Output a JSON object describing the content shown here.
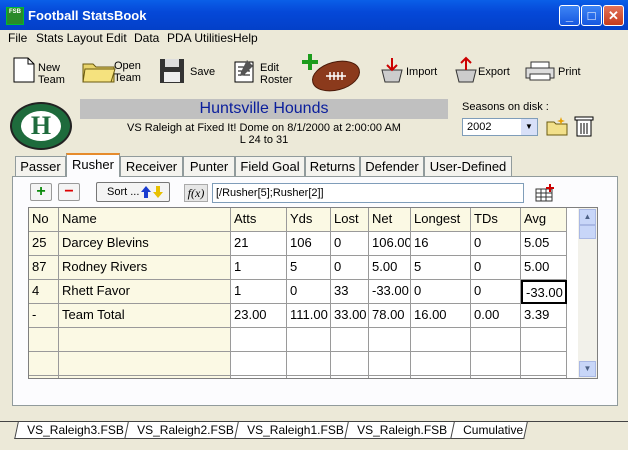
{
  "window": {
    "title": "Football StatsBook",
    "minimize": "_",
    "maximize": "□",
    "close": "✕",
    "app_icon_text": "FSB"
  },
  "menu": [
    "File",
    "Stats Layout",
    "Edit",
    "Data",
    "PDA Utilities",
    "Help"
  ],
  "toolbar": {
    "new_team": [
      "New",
      "Team"
    ],
    "open_team": [
      "Open",
      "Team"
    ],
    "save": "Save",
    "edit_roster": [
      "Edit",
      "Roster"
    ],
    "import": "Import",
    "export": "Export",
    "print": "Print"
  },
  "header": {
    "logo_letter": "H",
    "team_name": "Huntsville Hounds",
    "game_line": "VS Raleigh at Fixed It! Dome on 8/1/2000 at 2:00:00 AM",
    "score_line": "L 24 to 31",
    "seasons_label": "Seasons on disk :",
    "season_selected": "2002"
  },
  "tabs": [
    "Passer",
    "Rusher",
    "Receiver",
    "Punter",
    "Field Goal",
    "Returns",
    "Defender",
    "User-Defined"
  ],
  "active_tab": "Rusher",
  "actions": {
    "add": "+",
    "remove": "−",
    "sort_label": "Sort ...",
    "fx_label": "f(x)",
    "formula": "[/Rusher[5];Rusher[2]]"
  },
  "grid": {
    "columns": [
      "No",
      "Name",
      "Atts",
      "Yds",
      "Lost",
      "Net",
      "Longest",
      "TDs",
      "Avg"
    ],
    "rows": [
      [
        "25",
        "Darcey Blevins",
        "21",
        "106",
        "0",
        "106.00",
        "16",
        "0",
        "5.05"
      ],
      [
        "87",
        "Rodney Rivers",
        "1",
        "5",
        "0",
        "5.00",
        "5",
        "0",
        "5.00"
      ],
      [
        "4",
        "Rhett Favor",
        "1",
        "0",
        "33",
        "-33.00",
        "0",
        "0",
        "-33.00"
      ],
      [
        "-",
        "Team Total",
        "23.00",
        "111.00",
        "33.00",
        "78.00",
        "16.00",
        "0.00",
        "3.39"
      ],
      [
        "",
        "",
        "",
        "",
        "",
        "",
        "",
        "",
        ""
      ],
      [
        "",
        "",
        "",
        "",
        "",
        "",
        "",
        "",
        ""
      ],
      [
        "",
        "",
        "",
        "",
        "",
        "",
        "",
        "",
        ""
      ]
    ]
  },
  "file_tabs": [
    "VS_Raleigh3.FSB",
    "VS_Raleigh2.FSB",
    "VS_Raleigh1.FSB",
    "VS_Raleigh.FSB",
    "Cumulative"
  ],
  "active_file_tab": "VS_Raleigh3.FSB"
}
